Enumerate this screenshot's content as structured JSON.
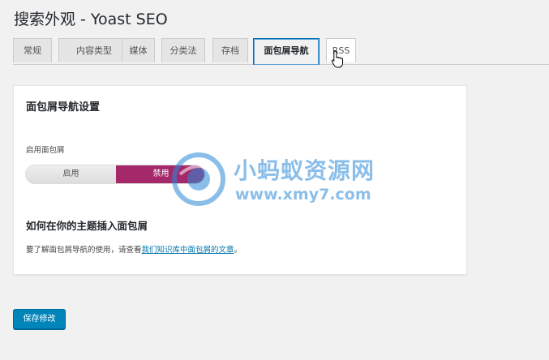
{
  "page": {
    "title": "搜索外观 - Yoast SEO"
  },
  "tabs": [
    {
      "label": "常规"
    },
    {
      "label": "内容类型"
    },
    {
      "label": "媒体"
    },
    {
      "label": "分类法"
    },
    {
      "label": "存档"
    },
    {
      "label": "面包屑导航",
      "active": true
    },
    {
      "label": "RSS"
    }
  ],
  "panel": {
    "title": "面包屑导航设置",
    "toggle_label": "启用面包屑",
    "toggle_on": "启用",
    "toggle_off": "禁用",
    "selected": "禁用",
    "howto_title": "如何在你的主题插入面包屑",
    "help_prefix": "要了解面包屑导航的使用，请查看",
    "help_link": "我们知识库中面包屑的文章",
    "help_suffix": "。"
  },
  "footer": {
    "save_label": "保存修改"
  },
  "watermark": {
    "text": "小蚂蚁资源网",
    "url": "www.xmy7.com"
  },
  "colors": {
    "accent": "#0085ba",
    "toggle_selected": "#a4286a",
    "link": "#0073aa"
  }
}
